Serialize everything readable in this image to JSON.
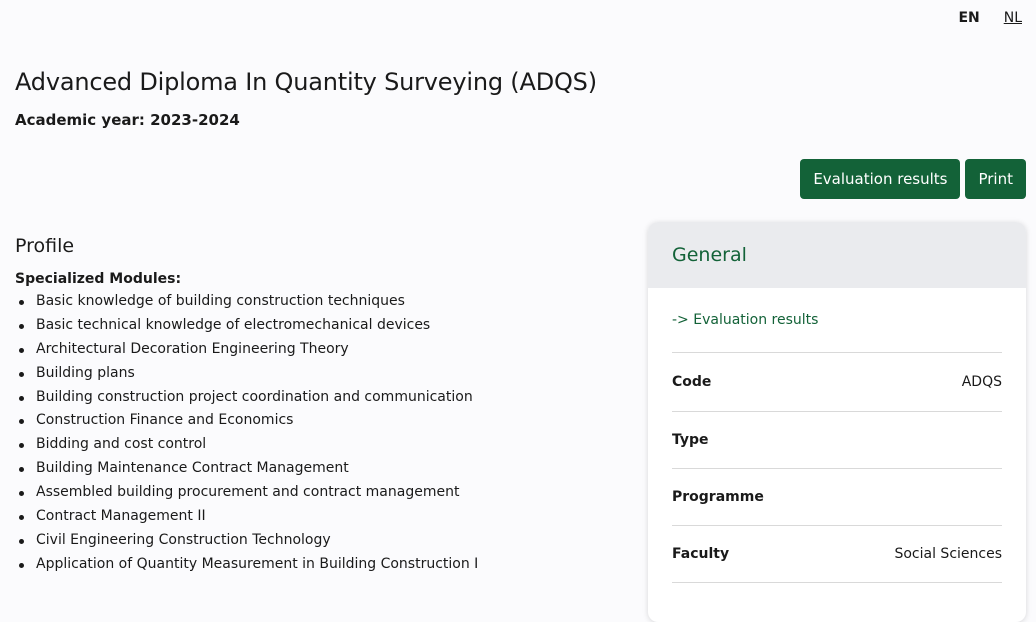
{
  "language": {
    "current": "EN",
    "other": "NL"
  },
  "page": {
    "title": "Advanced Diploma In Quantity Surveying (ADQS)",
    "academic_year": "Academic year: 2023-2024"
  },
  "actions": {
    "evaluation_label": "Evaluation results",
    "print_label": "Print"
  },
  "profile": {
    "heading": "Profile",
    "modules_label": "Specialized Modules:",
    "modules": [
      "Basic knowledge of building construction techniques",
      "Basic technical knowledge of electromechanical devices",
      "Architectural Decoration Engineering Theory",
      "Building plans",
      "Building construction project coordination and communication",
      "Construction Finance and Economics",
      "Bidding and cost control",
      "Building Maintenance Contract Management",
      "Assembled building procurement and contract management",
      "Contract Management II",
      "Civil Engineering Construction Technology",
      "Application of Quantity Measurement in Building Construction I"
    ]
  },
  "general": {
    "heading": "General",
    "evaluation_link": "-> Evaluation results",
    "rows": [
      {
        "key": "Code",
        "value": "ADQS"
      },
      {
        "key": "Type",
        "value": ""
      },
      {
        "key": "Programme",
        "value": ""
      },
      {
        "key": "Faculty",
        "value": "Social Sciences"
      }
    ]
  },
  "colors": {
    "accent": "#136238",
    "header_bg": "#eaebee"
  }
}
